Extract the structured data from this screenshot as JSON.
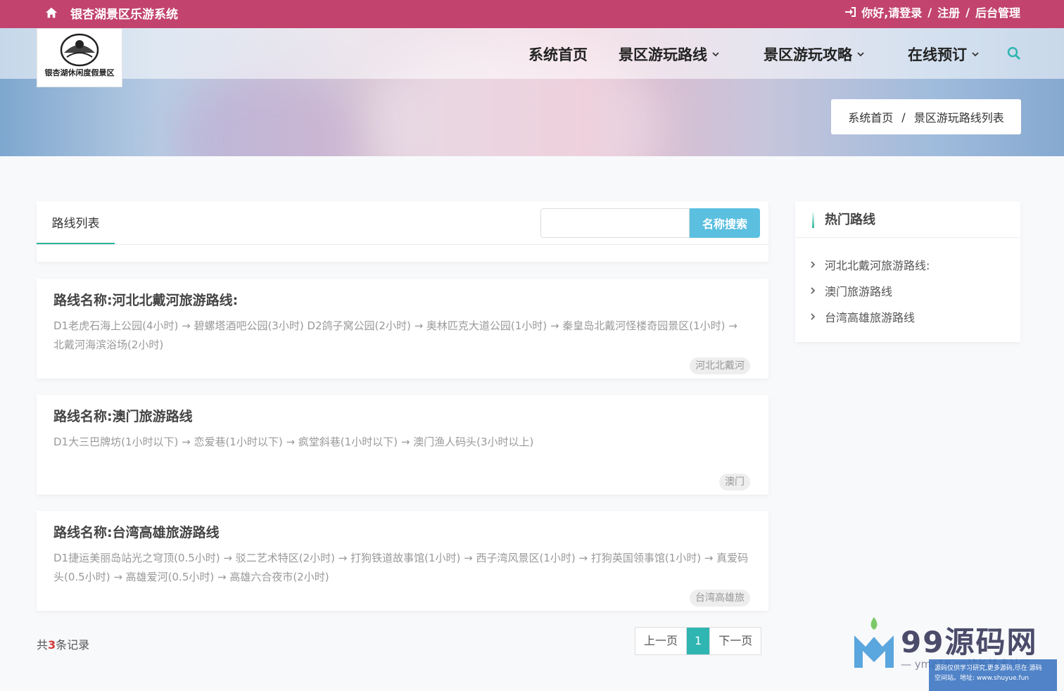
{
  "topbar": {
    "site_title": "银杏湖景区乐游系统",
    "greeting": "你好,请登录",
    "sep1": "/",
    "register": "注册",
    "sep2": "/",
    "admin": "后台管理"
  },
  "logo": {
    "text": "银杏湖休闲度假景区"
  },
  "nav": {
    "home": "系统首页",
    "routes": "景区游玩路线",
    "guides": "景区游玩攻略",
    "booking": "在线预订"
  },
  "breadcrumb": {
    "home": "系统首页",
    "sep": "/",
    "current": "景区游玩路线列表"
  },
  "list": {
    "tab_label": "路线列表",
    "search_placeholder": "",
    "search_button": "名称搜索",
    "routes": [
      {
        "title": "路线名称:河北北戴河旅游路线:",
        "desc": "D1老虎石海上公园(4小时) → 碧螺塔酒吧公园(3小时) D2鸽子窝公园(2小时) → 奥林匹克大道公园(1小时) → 秦皇岛北戴河怪楼奇园景区(1小时) → 北戴河海滨浴场(2小时)",
        "tag": "河北北戴河"
      },
      {
        "title": "路线名称:澳门旅游路线",
        "desc": "D1大三巴牌坊(1小时以下) → 恋爱巷(1小时以下) → 疯堂斜巷(1小时以下) → 澳门渔人码头(3小时以上)",
        "tag": "澳门"
      },
      {
        "title": "路线名称:台湾高雄旅游路线",
        "desc": "D1捷运美丽岛站光之穹顶(0.5小时) → 驳二艺术特区(2小时) → 打狗铁道故事馆(1小时) → 西子湾风景区(1小时) → 打狗英国领事馆(1小时) → 真爱码头(0.5小时) → 高雄爱河(0.5小时) → 高雄六合夜市(2小时)",
        "tag": "台湾高雄旅"
      }
    ]
  },
  "footer_list": {
    "total_prefix": "共",
    "total_count": "3",
    "total_suffix": "条记录",
    "prev": "上一页",
    "current_page": "1",
    "next": "下一页"
  },
  "sidebar": {
    "title": "热门路线",
    "items": [
      {
        "label": "河北北戴河旅游路线:"
      },
      {
        "label": "澳门旅游路线"
      },
      {
        "label": "台湾高雄旅游路线"
      }
    ]
  },
  "watermark": {
    "brand": "99源码网",
    "sub": "— yma16.cn站长技术社区",
    "box_line1": "源码仅供学习研究,更多源码,尽在·源码",
    "box_line2": "空间站。地址: www.shuyue.fun"
  },
  "colors": {
    "topbar": "#c2436e",
    "accent": "#2fb59a",
    "search_button": "#5bbfe0",
    "count_red": "#d23b3b"
  },
  "icons": [
    "home-icon",
    "login-icon",
    "chevron-down-icon",
    "search-icon",
    "chevron-right-icon"
  ]
}
